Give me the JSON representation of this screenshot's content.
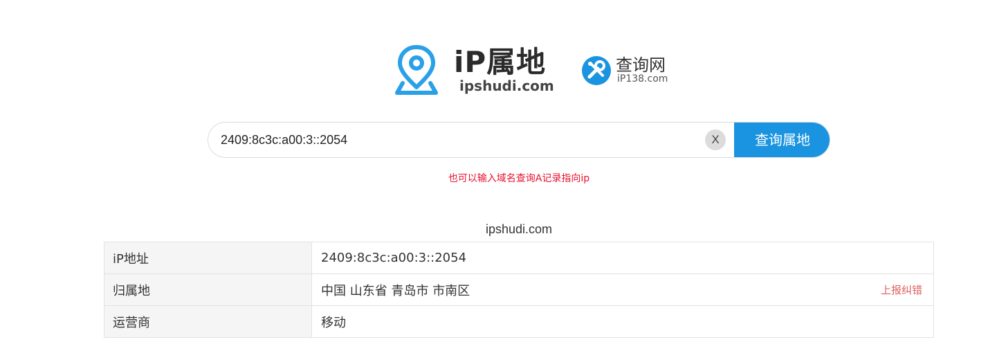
{
  "logos": {
    "ipshudi_title": "iP属地",
    "ipshudi_sub": "ipshudi.com",
    "ip138_title": "查询网",
    "ip138_sub": "iP138.com"
  },
  "colors": {
    "accent": "#1a94e0",
    "hint": "#e8112c",
    "report": "#e06060",
    "pin": "#2aa0e8"
  },
  "search": {
    "value": "2409:8c3c:a00:3::2054",
    "clear_label": "X",
    "button_label": "查询属地",
    "hint": "也可以输入域名查询A记录指向ip"
  },
  "result": {
    "site": "ipshudi.com",
    "rows": [
      {
        "label": "iP地址",
        "value": "2409:8c3c:a00:3::2054"
      },
      {
        "label": "归属地",
        "value": "中国 山东省 青岛市 市南区",
        "action": "上报纠错"
      },
      {
        "label": "运营商",
        "value": "移动"
      }
    ]
  }
}
